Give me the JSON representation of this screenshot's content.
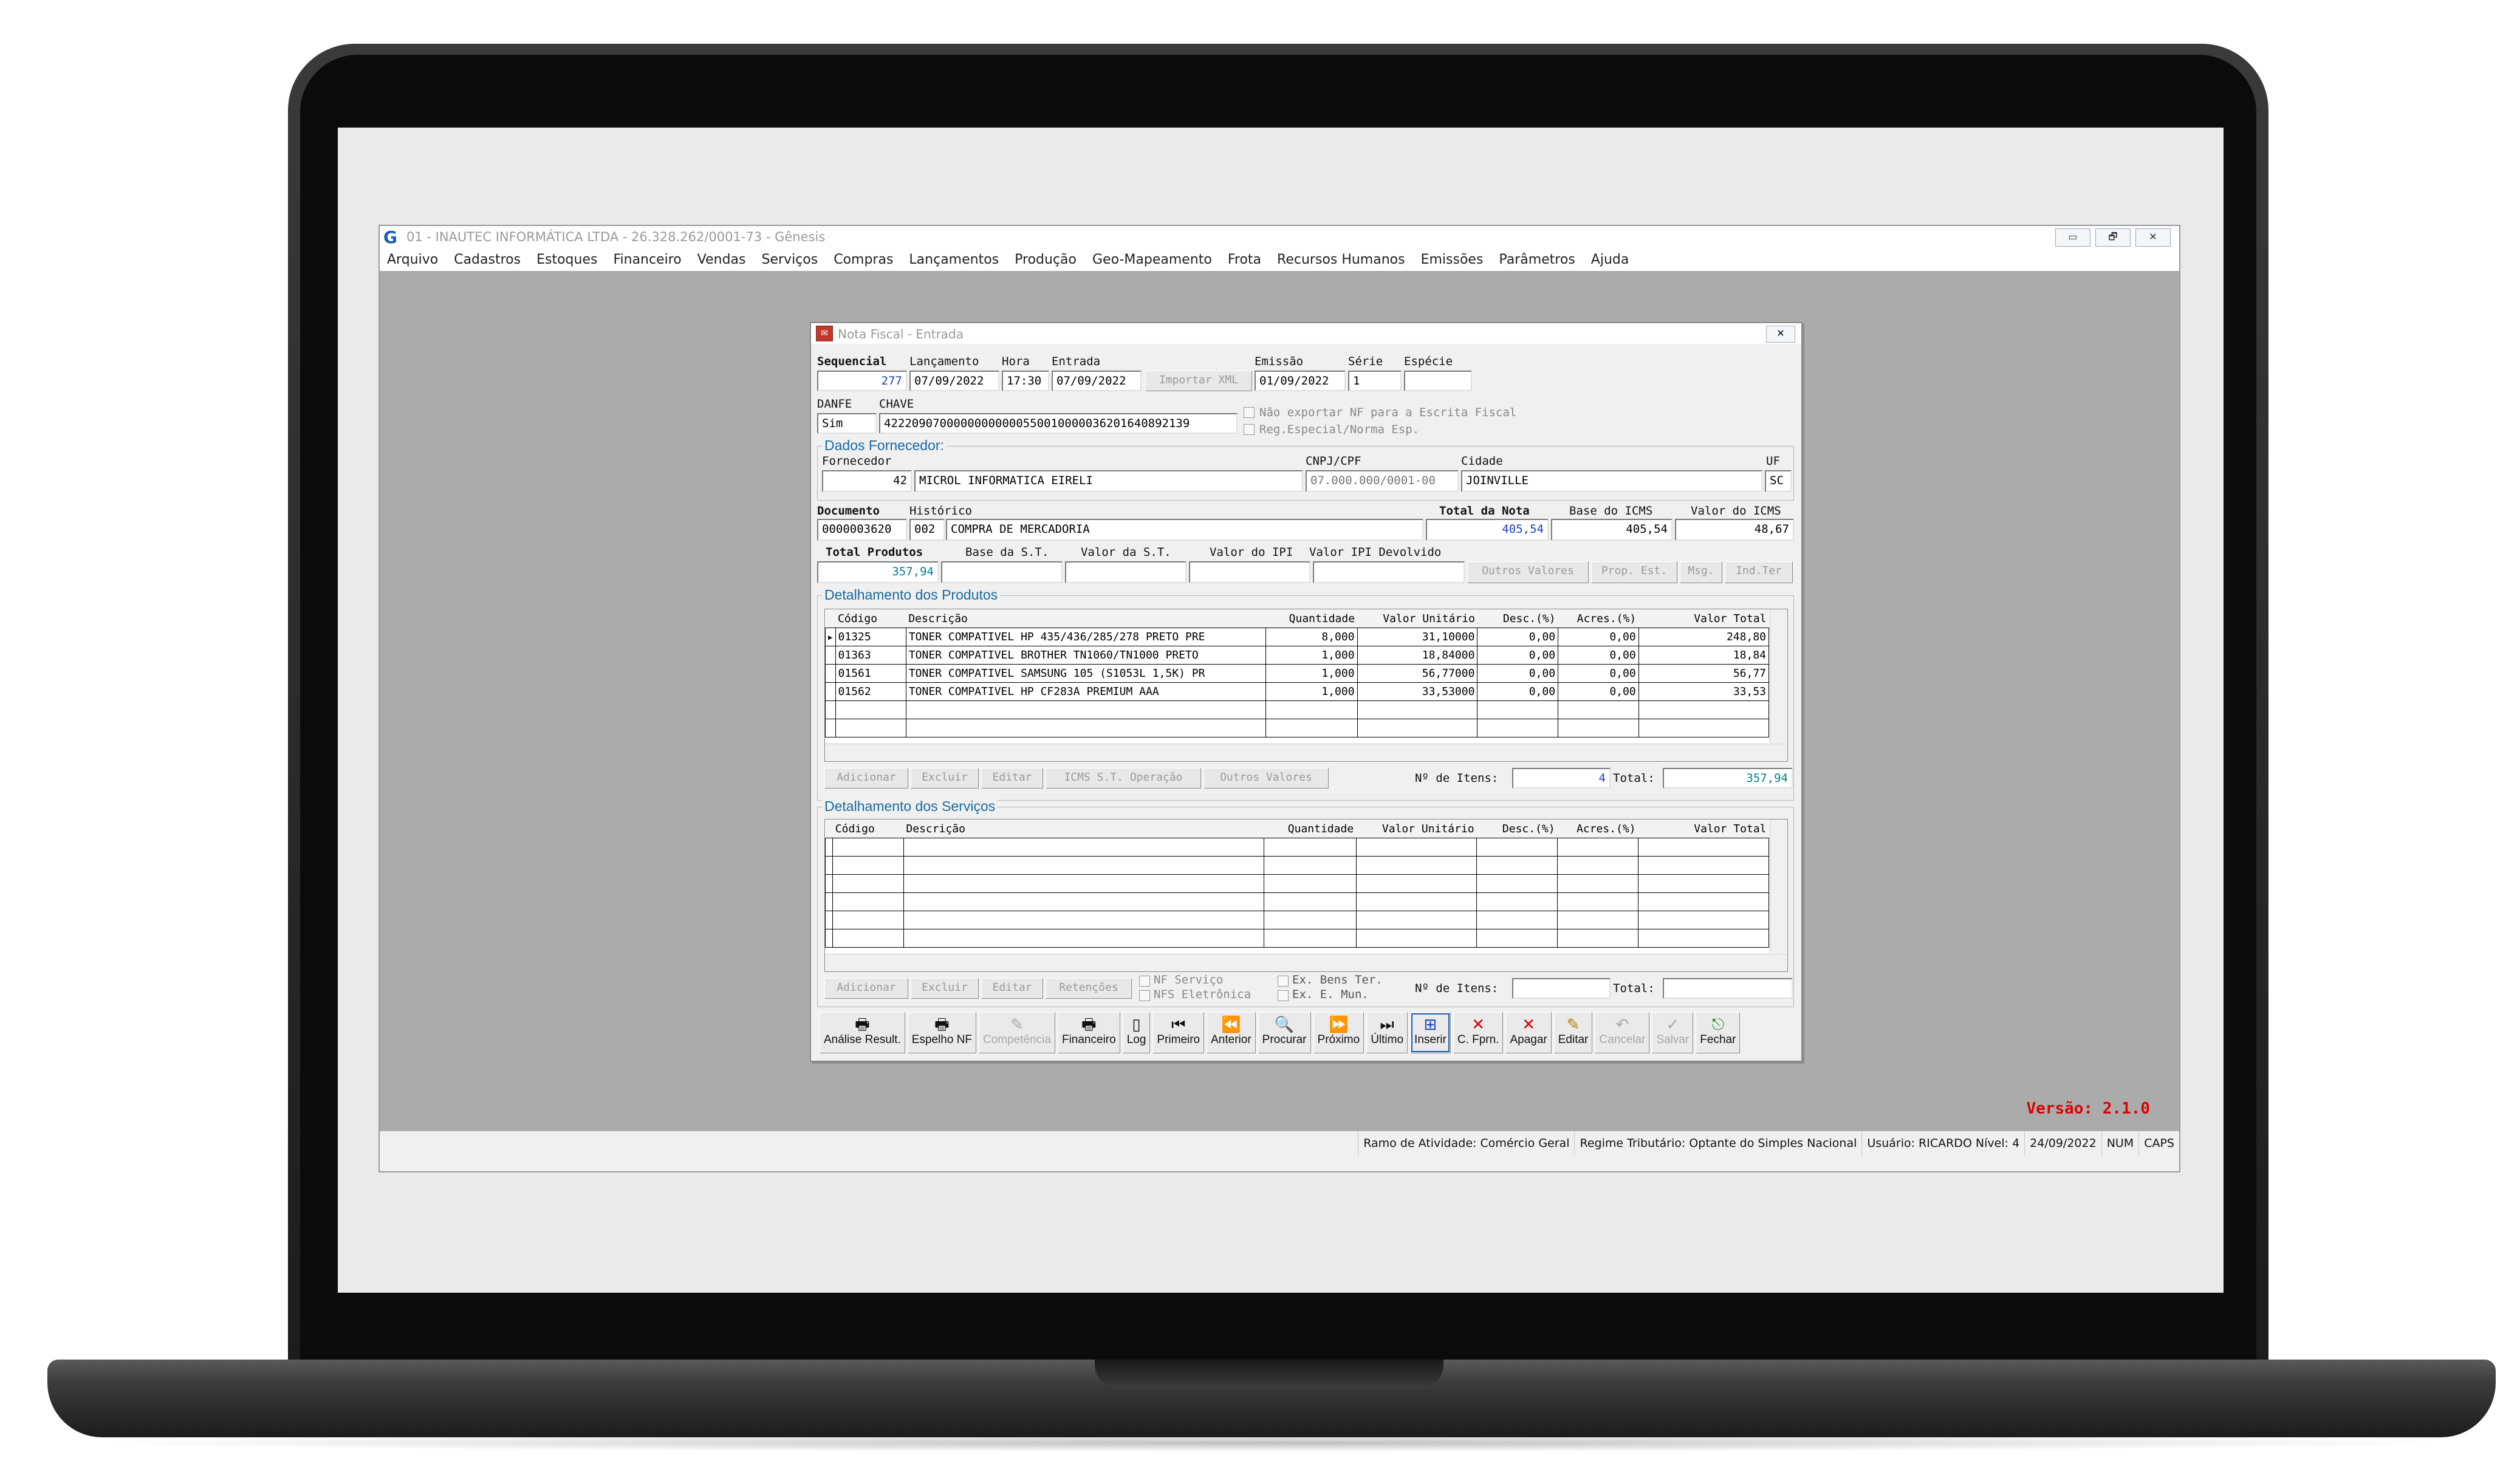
{
  "window": {
    "title": "01 - INAUTEC INFORMÁTICA LTDA - 26.328.262/0001-73 - Gênesis",
    "logo": "G",
    "controls": [
      "▭",
      "🗗",
      "✕"
    ]
  },
  "menu": [
    "Arquivo",
    "Cadastros",
    "Estoques",
    "Financeiro",
    "Vendas",
    "Serviços",
    "Compras",
    "Lançamentos",
    "Produção",
    "Geo-Mapeamento",
    "Frota",
    "Recursos Humanos",
    "Emissões",
    "Parâmetros",
    "Ajuda"
  ],
  "version": "Versão: 2.1.0",
  "status": [
    "Ramo de Atividade: Comércio Geral",
    "Regime Tributário: Optante do Simples Nacional",
    "Usuário: RICARDO Nível: 4",
    "24/09/2022",
    "NUM",
    "CAPS"
  ],
  "dialog": {
    "title": "Nota Fiscal - Entrada",
    "close": "✕",
    "labels": {
      "sequencial": "Sequencial",
      "lancamento": "Lançamento",
      "hora": "Hora",
      "entrada": "Entrada",
      "emissao": "Emissão",
      "serie": "Série",
      "especie": "Espécie",
      "danfe": "DANFE",
      "chave": "CHAVE",
      "nao_exportar": "Não exportar NF para a Escrita Fiscal",
      "reg_especial": "Reg.Especial/Norma Esp.",
      "fornecedor": "Fornecedor",
      "cnpj": "CNPJ/CPF",
      "cidade": "Cidade",
      "uf": "UF",
      "documento": "Documento",
      "historico": "Histórico",
      "total_nota": "Total da Nota",
      "base_icms": "Base do ICMS",
      "valor_icms": "Valor do ICMS",
      "total_produtos": "Total Produtos",
      "base_st": "Base da S.T.",
      "valor_st": "Valor da S.T.",
      "valor_ipi": "Valor do IPI",
      "valor_ipi_dev": "Valor IPI Devolvido",
      "n_itens": "Nº de Itens:",
      "total": "Total:"
    },
    "values": {
      "sequencial": "277",
      "lancamento": "07/09/2022",
      "hora": "17:30",
      "entrada": "07/09/2022",
      "importar_xml": "Importar XML",
      "emissao": "01/09/2022",
      "serie": "1",
      "especie": "",
      "danfe": "Sim",
      "chave": "42220907000000000000550010000036201640892139",
      "fornecedor_cod": "42",
      "fornecedor_nome": "MICROL INFORMATICA EIRELI",
      "cnpj": "07.000.000/0001-00",
      "cidade": "JOINVILLE",
      "uf": "SC",
      "documento": "0000003620",
      "historico_cod": "002",
      "historico": "COMPRA DE MERCADORIA",
      "total_nota": "405,54",
      "base_icms": "405,54",
      "valor_icms": "48,67",
      "total_produtos": "357,94",
      "base_st": "",
      "valor_st": "",
      "valor_ipi": "",
      "valor_ipi_dev": ""
    },
    "value_buttons": [
      "Outros Valores",
      "Prop. Est.",
      "Msg.",
      "Ind.Ter"
    ],
    "fornecedor_group": "Dados Fornecedor:",
    "produtos": {
      "title": "Detalhamento dos Produtos",
      "columns": [
        "Código",
        "Descrição",
        "Quantidade",
        "Valor Unitário",
        "Desc.(%)",
        "Acres.(%)",
        "Valor Total"
      ],
      "rows": [
        [
          "01325",
          "TONER COMPATIVEL HP 435/436/285/278 PRETO PRE",
          "8,000",
          "31,10000",
          "0,00",
          "0,00",
          "248,80"
        ],
        [
          "01363",
          "TONER COMPATIVEL BROTHER TN1060/TN1000 PRETO",
          "1,000",
          "18,84000",
          "0,00",
          "0,00",
          "18,84"
        ],
        [
          "01561",
          "TONER COMPATIVEL SAMSUNG 105 (S1053L 1,5K) PR",
          "1,000",
          "56,77000",
          "0,00",
          "0,00",
          "56,77"
        ],
        [
          "01562",
          "TONER COMPATIVEL HP CF283A PREMIUM AAA",
          "1,000",
          "33,53000",
          "0,00",
          "0,00",
          "33,53"
        ]
      ],
      "buttons": [
        "Adicionar",
        "Excluir",
        "Editar",
        "ICMS S.T. Operação",
        "Outros Valores"
      ],
      "n_itens": "4",
      "total": "357,94"
    },
    "servicos": {
      "title": "Detalhamento dos Serviços",
      "columns": [
        "Código",
        "Descrição",
        "Quantidade",
        "Valor Unitário",
        "Desc.(%)",
        "Acres.(%)",
        "Valor Total"
      ],
      "buttons": [
        "Adicionar",
        "Excluir",
        "Editar",
        "Retenções"
      ],
      "chk_nf_servico": "NF Serviço",
      "chk_nfs_eletronica": "NFS Eletrônica",
      "chk_ex_bens": "Ex. Bens Ter.",
      "chk_ex_mun": "Ex. E. Mun.",
      "n_itens": "",
      "total": ""
    },
    "toolbar": [
      {
        "label": "Análise Result.",
        "icon": "🖶",
        "name": "analise-result-button",
        "dis": false
      },
      {
        "label": "Espelho NF",
        "icon": "🖶",
        "name": "espelho-nf-button",
        "dis": false
      },
      {
        "label": "Competência",
        "icon": "✎",
        "name": "competencia-button",
        "dis": true
      },
      {
        "label": "Financeiro",
        "icon": "🖶",
        "name": "financeiro-button",
        "dis": false
      },
      {
        "label": "Log",
        "icon": "▯",
        "name": "log-button",
        "dis": false
      },
      {
        "label": "Primeiro",
        "icon": "⏮",
        "name": "primeiro-button",
        "dis": false
      },
      {
        "label": "Anterior",
        "icon": "⏪",
        "name": "anterior-button",
        "dis": false
      },
      {
        "label": "Procurar",
        "icon": "🔍",
        "name": "procurar-button",
        "dis": false
      },
      {
        "label": "Próximo",
        "icon": "⏩",
        "name": "proximo-button",
        "dis": false
      },
      {
        "label": "Último",
        "icon": "⏭",
        "name": "ultimo-button",
        "dis": false
      },
      {
        "label": "Inserir",
        "icon": "⊞",
        "name": "inserir-button",
        "dis": false,
        "sel": true
      },
      {
        "label": "C. Fprn.",
        "icon": "✕",
        "name": "c-fprn-button",
        "dis": false
      },
      {
        "label": "Apagar",
        "icon": "✕",
        "name": "apagar-button",
        "dis": false
      },
      {
        "label": "Editar",
        "icon": "✎",
        "name": "editar-button",
        "dis": false
      },
      {
        "label": "Cancelar",
        "icon": "↶",
        "name": "cancelar-button",
        "dis": true
      },
      {
        "label": "Salvar",
        "icon": "✓",
        "name": "salvar-button",
        "dis": true
      },
      {
        "label": "Fechar",
        "icon": "⎋",
        "name": "fechar-button",
        "dis": false
      }
    ]
  },
  "colors": {
    "accent": "#1a6aa0",
    "version_red": "#e00000",
    "value_blue": "#1a3fbf",
    "value_teal": "#00808f"
  }
}
